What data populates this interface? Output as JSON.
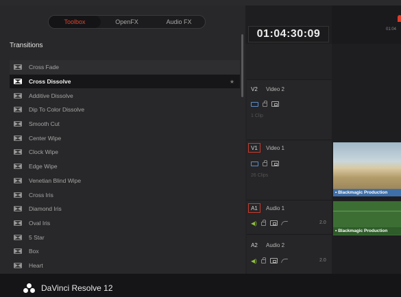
{
  "effects_panel": {
    "tabs": [
      {
        "label": "Toolbox",
        "active": true
      },
      {
        "label": "OpenFX",
        "active": false
      },
      {
        "label": "Audio FX",
        "active": false
      }
    ],
    "section_title": "Transitions",
    "items": [
      {
        "label": "Cross Fade"
      },
      {
        "label": "Cross Dissolve",
        "selected": true,
        "star": "★"
      },
      {
        "label": "Additive Dissolve"
      },
      {
        "label": "Dip To Color Dissolve"
      },
      {
        "label": "Smooth Cut"
      },
      {
        "label": "Center Wipe"
      },
      {
        "label": "Clock Wipe"
      },
      {
        "label": "Edge Wipe"
      },
      {
        "label": "Venetian Blind Wipe"
      },
      {
        "label": "Cross Iris"
      },
      {
        "label": "Diamond Iris"
      },
      {
        "label": "Oval Iris"
      },
      {
        "label": "5 Star"
      },
      {
        "label": "Box"
      },
      {
        "label": "Heart"
      }
    ]
  },
  "timeline": {
    "timecode": "01:04:30:09",
    "ruler_label": "01:04",
    "tracks": {
      "v2": {
        "tag": "V2",
        "name": "Video 2",
        "clips": "1 Clip"
      },
      "v1": {
        "tag": "V1",
        "name": "Video 1",
        "clips": "26 Clips"
      },
      "a1": {
        "tag": "A1",
        "name": "Audio 1",
        "level": "2.0"
      },
      "a2": {
        "tag": "A2",
        "name": "Audio 2",
        "level": "2.0"
      }
    },
    "video_clip_label": "• Blackmagic Production",
    "audio_clip_label": "• Blackmagic Production"
  },
  "footer": {
    "app_name": "DaVinci Resolve 12"
  },
  "colors": {
    "accent_red": "#e0452f",
    "video_clip_bar": "#3f6fa8",
    "audio_clip": "#3c6e34"
  }
}
